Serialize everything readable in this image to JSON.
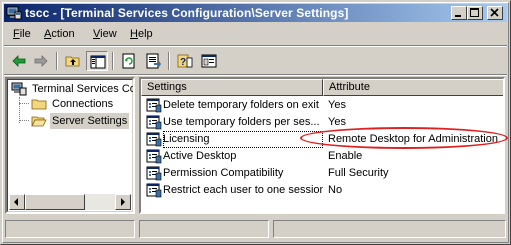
{
  "window": {
    "title": "tscc - [Terminal Services Configuration\\Server Settings]"
  },
  "menu": [
    {
      "label": "File",
      "accel": "F"
    },
    {
      "label": "Action",
      "accel": "A"
    },
    {
      "label": "View",
      "accel": "V"
    },
    {
      "label": "Help",
      "accel": "H"
    }
  ],
  "toolbar": {
    "icons": [
      "back-arrow-icon",
      "forward-arrow-icon",
      "up-folder-icon",
      "show-hide-tree-icon",
      "refresh-icon",
      "export-list-icon",
      "help-icon",
      "properties-icon"
    ]
  },
  "tree": {
    "root": "Terminal Services Cor",
    "children": [
      "Connections",
      "Server Settings"
    ],
    "selected": "Server Settings"
  },
  "list": {
    "columns": [
      "Settings",
      "Attribute"
    ],
    "rows": [
      {
        "setting": "Delete temporary folders on exit",
        "attribute": "Yes"
      },
      {
        "setting": "Use temporary folders per ses...",
        "attribute": "Yes"
      },
      {
        "setting": "Licensing",
        "attribute": "Remote Desktop for Administration"
      },
      {
        "setting": "Active Desktop",
        "attribute": "Enable"
      },
      {
        "setting": "Permission Compatibility",
        "attribute": "Full Security"
      },
      {
        "setting": "Restrict each user to one session",
        "attribute": "No"
      }
    ],
    "focused_row": 2
  },
  "colors": {
    "title_start": "#0a246a",
    "title_end": "#a6caf0",
    "face": "#d4d0c8",
    "annotation": "#e02020"
  }
}
